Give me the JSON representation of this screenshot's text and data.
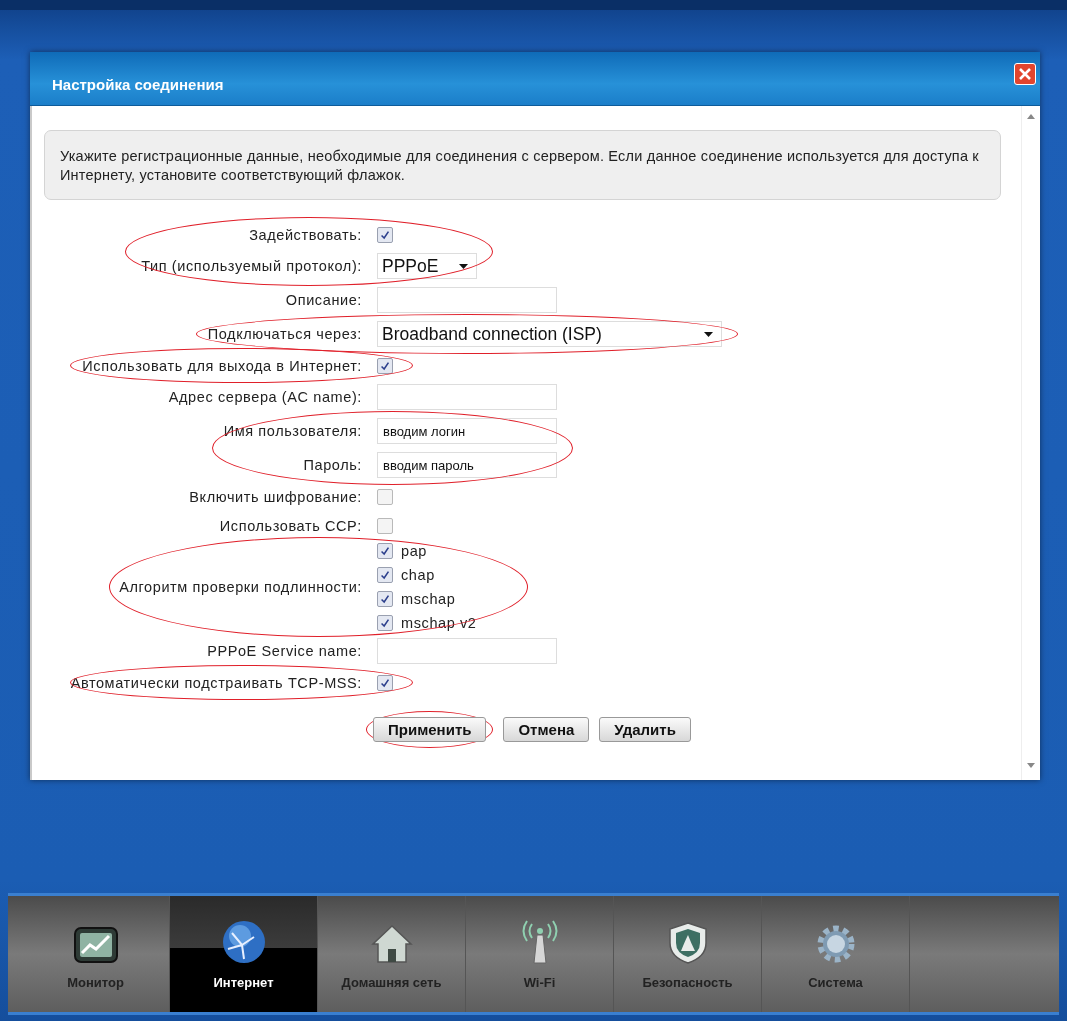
{
  "window": {
    "title": "Настройка соединения"
  },
  "intro": "Укажите регистрационные данные, необходимые для соединения с сервером. Если данное соединение используется для доступа к Интернету, установите соответствующий флажок.",
  "groups": [
    {
      "circled": true,
      "rows": [
        {
          "kind": "checkbox",
          "label": "Задействовать:",
          "checked": true
        },
        {
          "kind": "select",
          "label": "Тип (используемый протокол):",
          "value": "PPPoE",
          "wide": false
        }
      ]
    },
    {
      "circled": false,
      "rows": [
        {
          "kind": "text",
          "label": "Описание:"
        }
      ]
    },
    {
      "circled": true,
      "rows": [
        {
          "kind": "select",
          "label": "Подключаться через:",
          "value": "Broadband connection (ISP)",
          "wide": true
        }
      ]
    },
    {
      "circled": true,
      "rows": [
        {
          "kind": "checkbox",
          "label": "Использовать для выхода в Интернет:",
          "checked": true
        }
      ]
    },
    {
      "circled": false,
      "rows": [
        {
          "kind": "text",
          "label": "Адрес сервера (AC name):"
        }
      ]
    },
    {
      "circled": true,
      "rows": [
        {
          "kind": "text",
          "label": "Имя пользователя:",
          "value": "вводим логин"
        },
        {
          "kind": "text",
          "label": "Пароль:",
          "value": "вводим пароль"
        }
      ]
    },
    {
      "circled": false,
      "rows": [
        {
          "kind": "checkbox",
          "label": "Включить шифрование:",
          "checked": false
        },
        {
          "kind": "checkbox",
          "label": "Использовать CCP:",
          "checked": false
        }
      ]
    },
    {
      "circled": true,
      "rows": [
        {
          "kind": "checklist",
          "label": "Алгоритм проверки подлинности:",
          "options": [
            {
              "label": "pap",
              "checked": true
            },
            {
              "label": "chap",
              "checked": true
            },
            {
              "label": "mschap",
              "checked": true
            },
            {
              "label": "mschap v2",
              "checked": true
            }
          ]
        }
      ]
    },
    {
      "circled": false,
      "rows": [
        {
          "kind": "text",
          "label": "PPPoE Service name:"
        }
      ]
    },
    {
      "circled": true,
      "rows": [
        {
          "kind": "checkbox",
          "label": "Автоматически подстраивать TCP-MSS:",
          "checked": true
        }
      ]
    }
  ],
  "buttons": [
    {
      "label": "Применить",
      "circled": true
    },
    {
      "label": "Отмена",
      "circled": false
    },
    {
      "label": "Удалить",
      "circled": false
    }
  ],
  "nav": [
    {
      "label": "Монитор",
      "kind": "chart",
      "selected": false
    },
    {
      "label": "Интернет",
      "kind": "globe",
      "selected": true
    },
    {
      "label": "Домашняя сеть",
      "kind": "house",
      "selected": false
    },
    {
      "label": "Wi-Fi",
      "kind": "antenna",
      "selected": false
    },
    {
      "label": "Безопасность",
      "kind": "shield",
      "selected": false
    },
    {
      "label": "Система",
      "kind": "gear",
      "selected": false
    }
  ]
}
